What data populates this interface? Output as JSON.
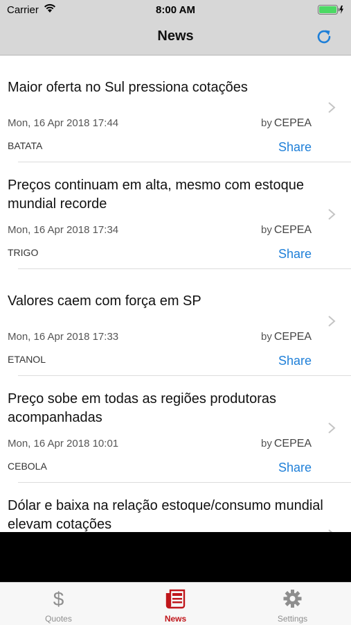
{
  "status_bar": {
    "carrier": "Carrier",
    "time": "8:00 AM"
  },
  "nav": {
    "title": "News"
  },
  "news": [
    {
      "title": "Maior oferta no Sul pressiona cotações",
      "date": "Mon, 16 Apr 2018 17:44",
      "by": "by",
      "source": "CEPEA",
      "category": "BATATA",
      "share": "Share"
    },
    {
      "title": "Preços continuam em alta, mesmo com estoque mundial recorde",
      "date": "Mon, 16 Apr 2018 17:34",
      "by": "by",
      "source": "CEPEA",
      "category": "TRIGO",
      "share": "Share"
    },
    {
      "title": "Valores caem com força em SP",
      "date": "Mon, 16 Apr 2018 17:33",
      "by": "by",
      "source": "CEPEA",
      "category": "ETANOL",
      "share": "Share"
    },
    {
      "title": "Preço sobe em todas as regiões produtoras acompanhadas",
      "date": "Mon, 16 Apr 2018 10:01",
      "by": "by",
      "source": "CEPEA",
      "category": "CEBOLA",
      "share": "Share"
    },
    {
      "title": "Dólar e baixa na relação estoque/consumo mundial elevam cotações",
      "date": "",
      "by": "",
      "source": "",
      "category": "",
      "share": ""
    }
  ],
  "tabs": [
    {
      "label": "Quotes",
      "icon": "dollar-icon"
    },
    {
      "label": "News",
      "icon": "newspaper-icon"
    },
    {
      "label": "Settings",
      "icon": "gear-icon"
    }
  ],
  "colors": {
    "accent": "#1e7fd8",
    "tab_active": "#c0161b",
    "tab_inactive": "#8e8e8e",
    "battery": "#4cd964"
  }
}
